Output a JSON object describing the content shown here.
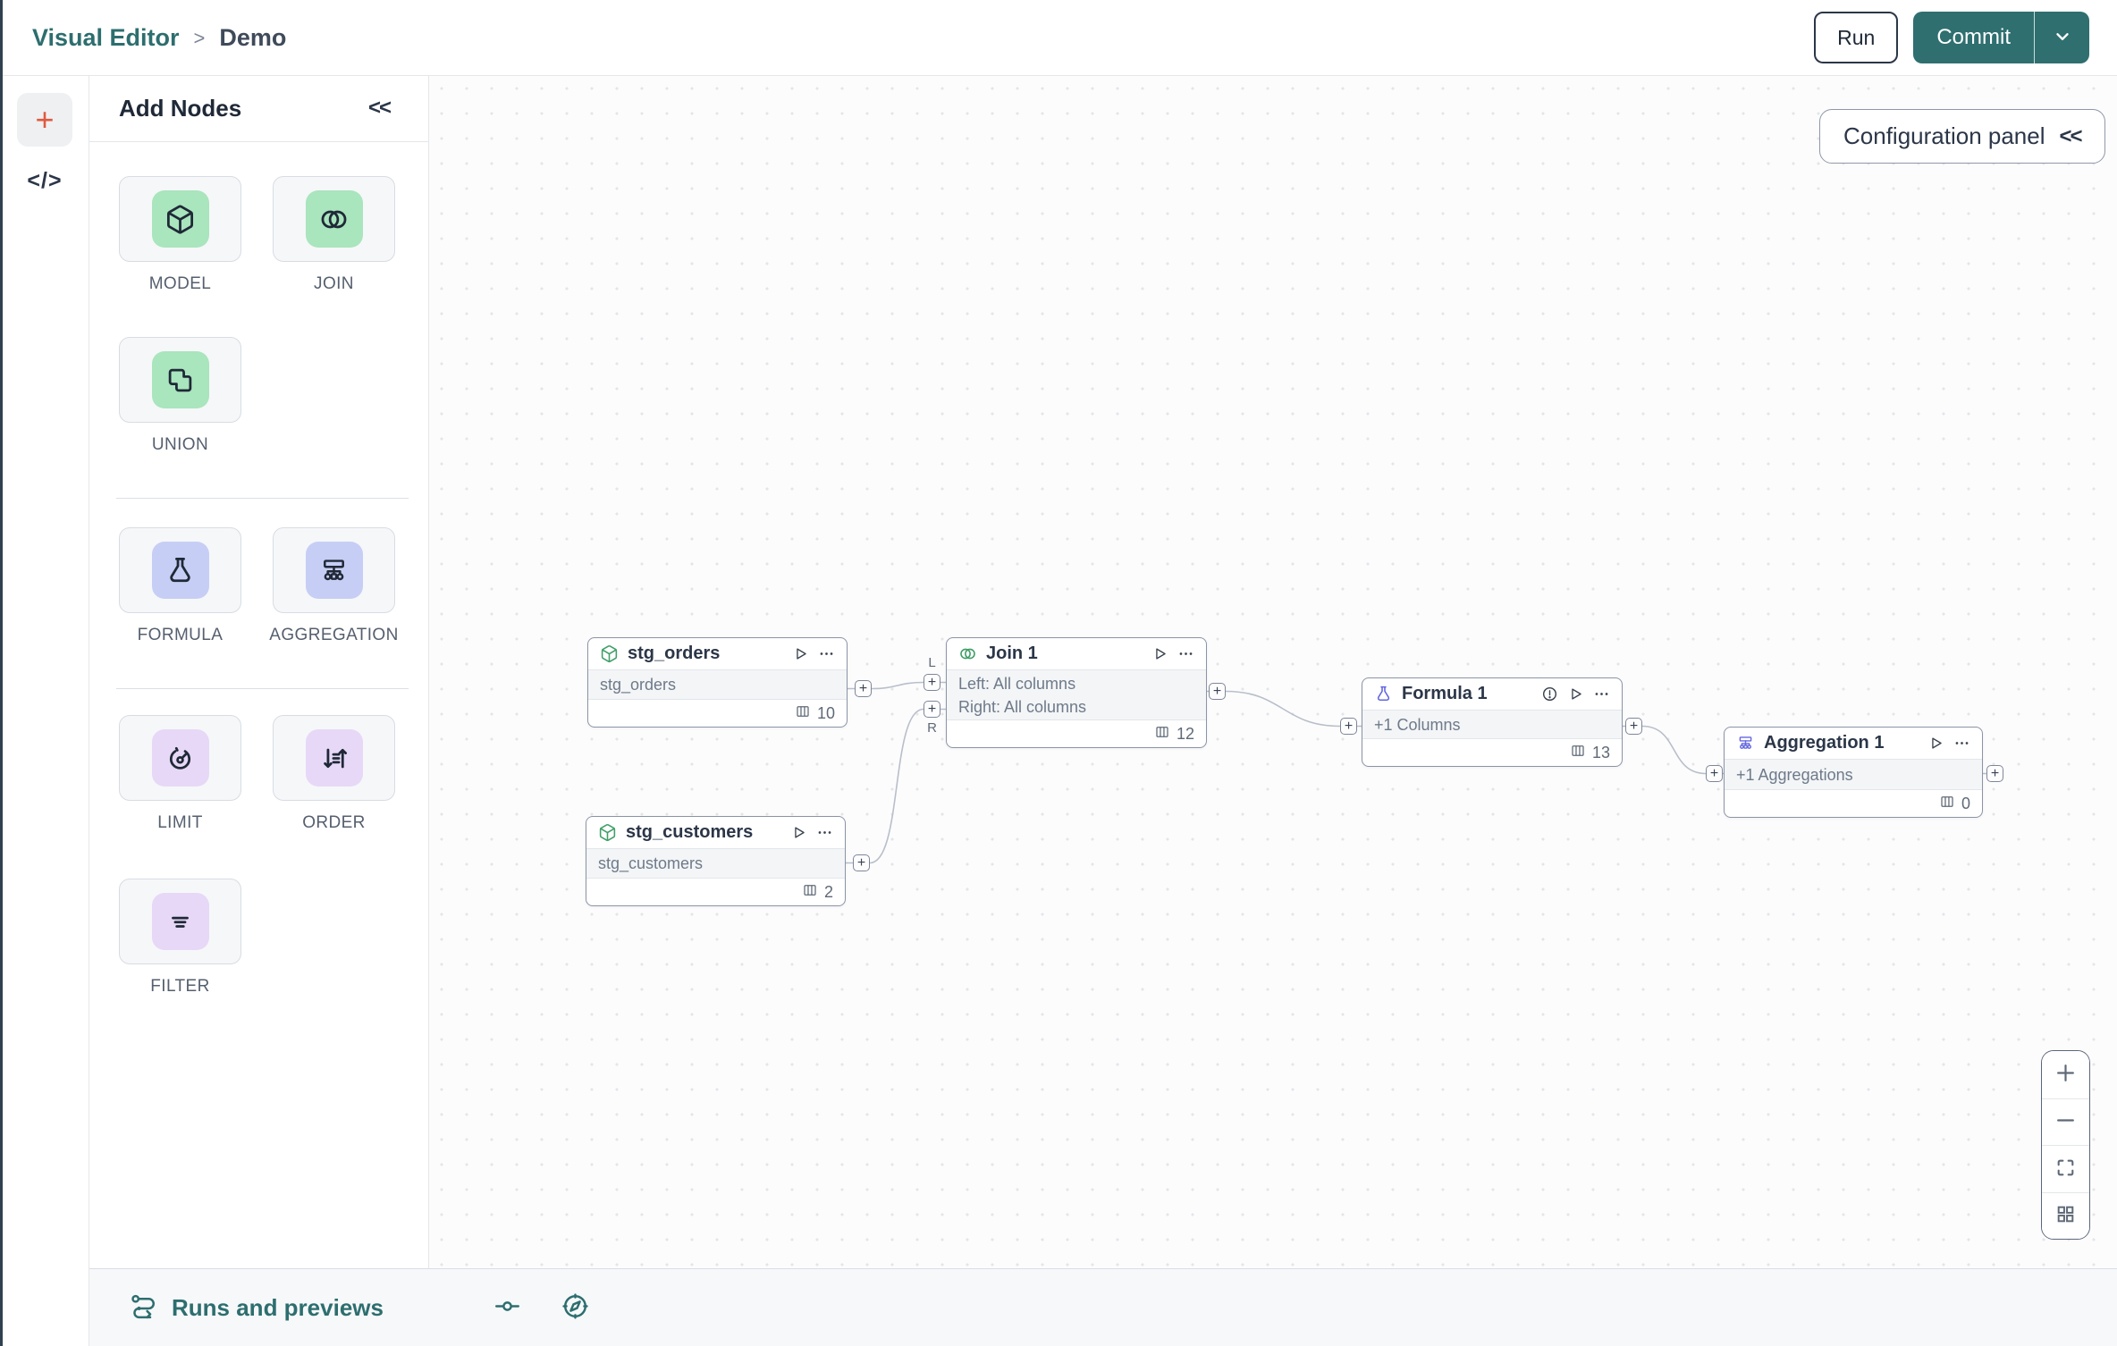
{
  "header": {
    "breadcrumb_root": "Visual Editor",
    "breadcrumb_sep": ">",
    "breadcrumb_current": "Demo",
    "run_label": "Run",
    "commit_label": "Commit"
  },
  "left_rail": {
    "add_icon": "+",
    "code_icon": "</>"
  },
  "add_nodes_panel": {
    "title": "Add Nodes",
    "collapse_icon": "<<",
    "tiles": [
      {
        "label": "MODEL",
        "icon": "cube-icon",
        "tint": "green"
      },
      {
        "label": "JOIN",
        "icon": "venn-icon",
        "tint": "green"
      },
      {
        "label": "UNION",
        "icon": "union-icon",
        "tint": "green"
      },
      {
        "label": "FORMULA",
        "icon": "flask-icon",
        "tint": "indigo"
      },
      {
        "label": "AGGREGATION",
        "icon": "aggregation-icon",
        "tint": "indigo"
      },
      {
        "label": "LIMIT",
        "icon": "gauge-icon",
        "tint": "purple"
      },
      {
        "label": "ORDER",
        "icon": "sort-icon",
        "tint": "purple"
      },
      {
        "label": "FILTER",
        "icon": "filter-icon",
        "tint": "purple"
      }
    ]
  },
  "canvas": {
    "config_panel_label": "Configuration panel",
    "config_collapse_icon": "<<",
    "plus_handle": "+",
    "nodes": [
      {
        "title": "stg_orders",
        "body": "stg_orders",
        "columns": "10"
      },
      {
        "title": "Join 1",
        "body_line1": "Left: All columns",
        "body_line2": "Right: All columns",
        "columns": "12",
        "left_port": "L",
        "right_port": "R"
      },
      {
        "title": "stg_customers",
        "body": "stg_customers",
        "columns": "2"
      },
      {
        "title": "Formula 1",
        "body": "+1 Columns",
        "columns": "13"
      },
      {
        "title": "Aggregation 1",
        "body": "+1 Aggregations",
        "columns": "0"
      }
    ]
  },
  "bottom_bar": {
    "runs_label": "Runs and previews"
  },
  "colors": {
    "brand_teal": "#2f6f70",
    "breadcrumb_teal": "#2d6e6f",
    "rail_plus_orange": "#e0593f",
    "tile_green": "#a9e5bd",
    "tile_indigo": "#c7cef5",
    "tile_purple": "#e7d8f7",
    "node_icon_green": "#3f9f68",
    "node_icon_indigo": "#6366e1",
    "warning_orange": "#b4682f",
    "edge_gray": "#b8bfc9"
  }
}
